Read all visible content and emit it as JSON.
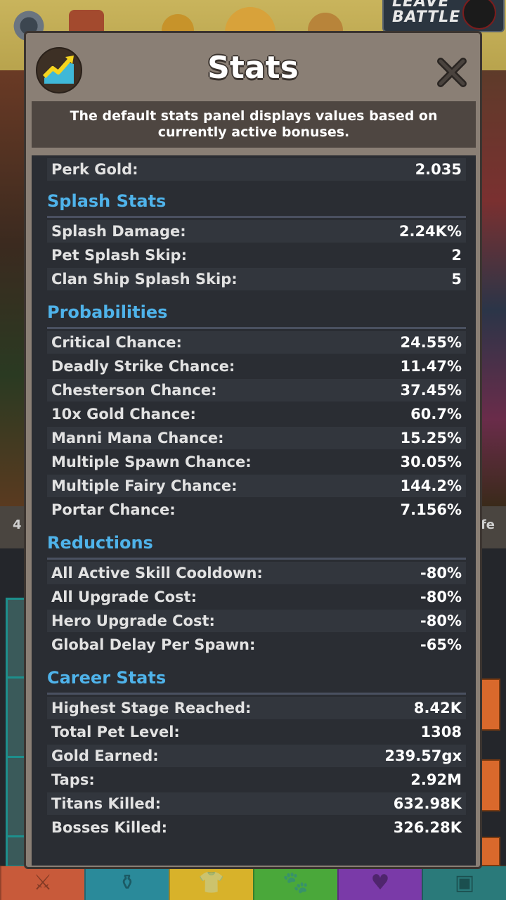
{
  "leave_battle": "LEAVE BATTLE",
  "modal": {
    "title": "Stats",
    "notice": "The default stats panel displays values based on currently active bonuses."
  },
  "top_row": {
    "label": "Perk Gold:",
    "value": "2.035"
  },
  "sections": [
    {
      "title": "Splash Stats",
      "rows": [
        {
          "label": "Splash Damage:",
          "value": "2.24K%"
        },
        {
          "label": "Pet Splash Skip:",
          "value": "2"
        },
        {
          "label": "Clan Ship Splash Skip:",
          "value": "5"
        }
      ]
    },
    {
      "title": "Probabilities",
      "rows": [
        {
          "label": "Critical Chance:",
          "value": "24.55%"
        },
        {
          "label": "Deadly Strike Chance:",
          "value": "11.47%"
        },
        {
          "label": "Chesterson Chance:",
          "value": "37.45%"
        },
        {
          "label": "10x Gold Chance:",
          "value": "60.7%"
        },
        {
          "label": "Manni Mana Chance:",
          "value": "15.25%"
        },
        {
          "label": "Multiple Spawn Chance:",
          "value": "30.05%"
        },
        {
          "label": "Multiple Fairy Chance:",
          "value": "144.2%"
        },
        {
          "label": "Portar Chance:",
          "value": "7.156%"
        }
      ]
    },
    {
      "title": "Reductions",
      "rows": [
        {
          "label": "All Active Skill Cooldown:",
          "value": "-80%"
        },
        {
          "label": "All Upgrade Cost:",
          "value": "-80%"
        },
        {
          "label": "Hero Upgrade Cost:",
          "value": "-80%"
        },
        {
          "label": "Global Delay Per Spawn:",
          "value": "-65%"
        }
      ]
    },
    {
      "title": "Career Stats",
      "rows": [
        {
          "label": "Highest Stage Reached:",
          "value": "8.42K"
        },
        {
          "label": "Total Pet Level:",
          "value": "1308"
        },
        {
          "label": "Gold Earned:",
          "value": "239.57gx"
        },
        {
          "label": "Taps:",
          "value": "2.92M"
        },
        {
          "label": "Titans Killed:",
          "value": "632.98K"
        },
        {
          "label": "Bosses Killed:",
          "value": "326.28K"
        }
      ]
    }
  ],
  "bottom_tabs": [
    {
      "icon": "sword-icon",
      "glyph": "⚔",
      "color": "#c85a3a"
    },
    {
      "icon": "potion-icon",
      "glyph": "⚱",
      "color": "#2a8a9a"
    },
    {
      "icon": "shirt-icon",
      "glyph": "👕",
      "color": "#d8b22a"
    },
    {
      "icon": "pet-icon",
      "glyph": "🐾",
      "color": "#4aa83a"
    },
    {
      "icon": "heart-icon",
      "glyph": "♥",
      "color": "#7a3aa8"
    },
    {
      "icon": "shop-icon",
      "glyph": "▣",
      "color": "#2a7a7a"
    }
  ]
}
